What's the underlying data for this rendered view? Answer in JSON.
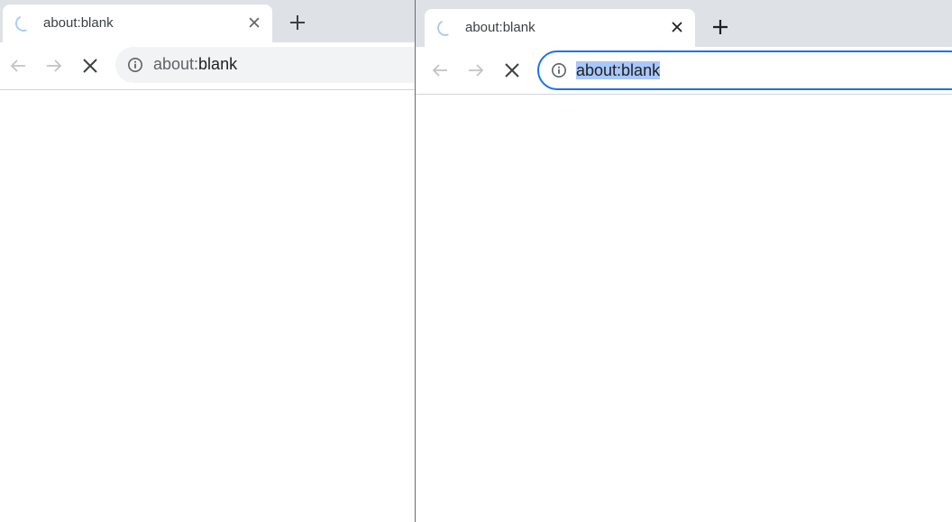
{
  "windows": [
    {
      "id": "background",
      "tab": {
        "title": "about:blank"
      },
      "omnibox": {
        "scheme": "about:",
        "host": "blank",
        "focused": false
      }
    },
    {
      "id": "foreground",
      "tab": {
        "title": "about:blank"
      },
      "omnibox": {
        "text": "about:blank",
        "focused": true,
        "selected": true
      }
    }
  ],
  "icons": {
    "loading": "loading-spinner-icon",
    "close": "close-icon",
    "new_tab": "plus-icon",
    "back": "back-arrow-icon",
    "forward": "forward-arrow-icon",
    "stop": "stop-x-icon",
    "site_info": "info-icon"
  },
  "colors": {
    "tabstrip": "#dee1e6",
    "focus_ring": "#1a73e8",
    "selection": "#a8c7fa",
    "spinner": "#a9cdf2"
  }
}
